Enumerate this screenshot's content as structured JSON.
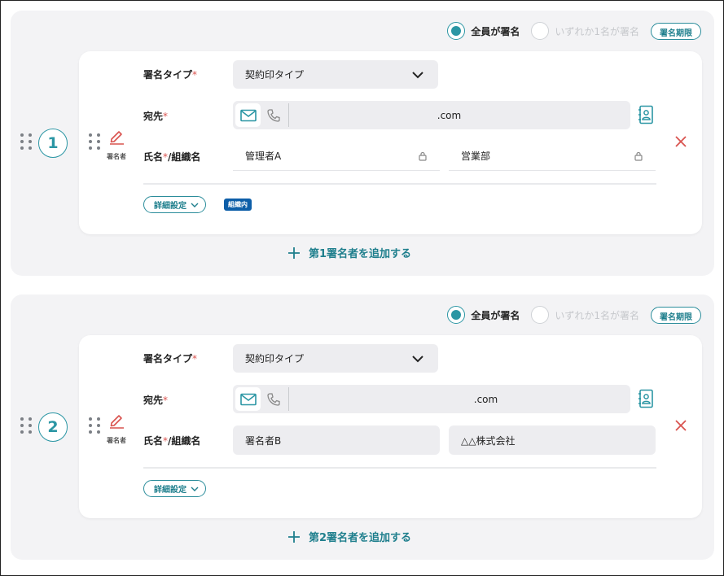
{
  "colors": {
    "accent": "#2b96a4",
    "danger": "#d9534f",
    "badge": "#0d5ea8",
    "panel": "#f3f3f5"
  },
  "signers": [
    {
      "number": "1",
      "role": "署名者",
      "option_all": "全員が署名",
      "option_any": "いずれか1名が署名",
      "deadline_btn": "署名期限",
      "type_label": "署名タイプ",
      "type_value": "契約印タイプ",
      "dest_label": "宛先",
      "dest_value": ".com",
      "name_label_a": "氏名",
      "name_label_b": "/組織名",
      "name_value": "管理者A",
      "org_value": "営業部",
      "detail_btn": "詳細設定",
      "badge": "組織内",
      "add_label": "第1署名者を追加する"
    },
    {
      "number": "2",
      "role": "署名者",
      "option_all": "全員が署名",
      "option_any": "いずれか1名が署名",
      "deadline_btn": "署名期限",
      "type_label": "署名タイプ",
      "type_value": "契約印タイプ",
      "dest_label": "宛先",
      "dest_value": ".com",
      "name_label_a": "氏名",
      "name_label_b": "/組織名",
      "name_value": "署名者B",
      "org_value": "△△株式会社",
      "detail_btn": "詳細設定",
      "add_label": "第2署名者を追加する"
    }
  ],
  "required_mark": "*",
  "icons": [
    "drag-handle-icon",
    "pencil-icon",
    "chevron-down-icon",
    "mail-icon",
    "phone-icon",
    "address-book-icon",
    "lock-icon",
    "close-icon",
    "plus-icon"
  ]
}
